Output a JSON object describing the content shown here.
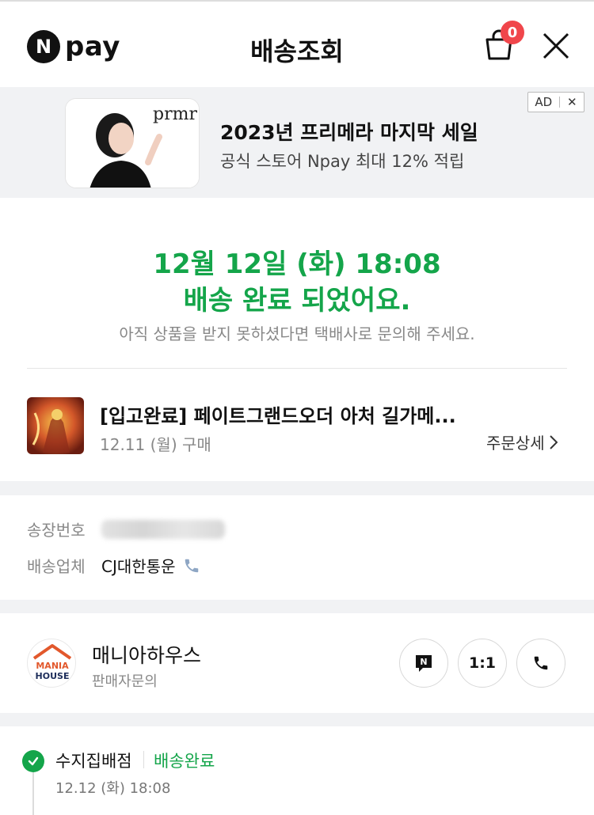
{
  "header": {
    "logo_mark": "N",
    "logo_text": "pay",
    "title": "배송조회",
    "cart_count": "0",
    "cart_icon": "shopping-bag-icon",
    "close_icon": "close-icon"
  },
  "ad": {
    "brand_mark": "prmr",
    "title": "2023년 프리메라 마지막 세일",
    "subtitle": "공식 스토어 Npay 최대 12% 적립",
    "badge_label": "AD",
    "badge_close": "✕"
  },
  "status": {
    "date": "12월 12일 (화) 18:08",
    "message": "배송 완료 되었어요.",
    "note": "아직 상품을 받지 못하셨다면 택배사로 문의해 주세요."
  },
  "product": {
    "name": "[입고완료] 페이트그랜드오더 아처 길가메...",
    "purchase_date": "12.11 (월) 구매",
    "order_detail_label": "주문상세"
  },
  "tracking": {
    "invoice_label": "송장번호",
    "carrier_label": "배송업체",
    "carrier_value": "CJ대한통운"
  },
  "seller": {
    "logo_line1": "MANIA",
    "logo_line2": "HOUSE",
    "name": "매니아하우스",
    "sub": "판매자문의",
    "talk_button_label": "N",
    "chat_button_label": "1:1"
  },
  "timeline": {
    "location": "수지집배점",
    "status": "배송완료",
    "time": "12.12 (화) 18:08"
  },
  "colors": {
    "accent_green": "#14a54a",
    "badge_red": "#f0464b",
    "gap_gray": "#f1f2f4"
  }
}
